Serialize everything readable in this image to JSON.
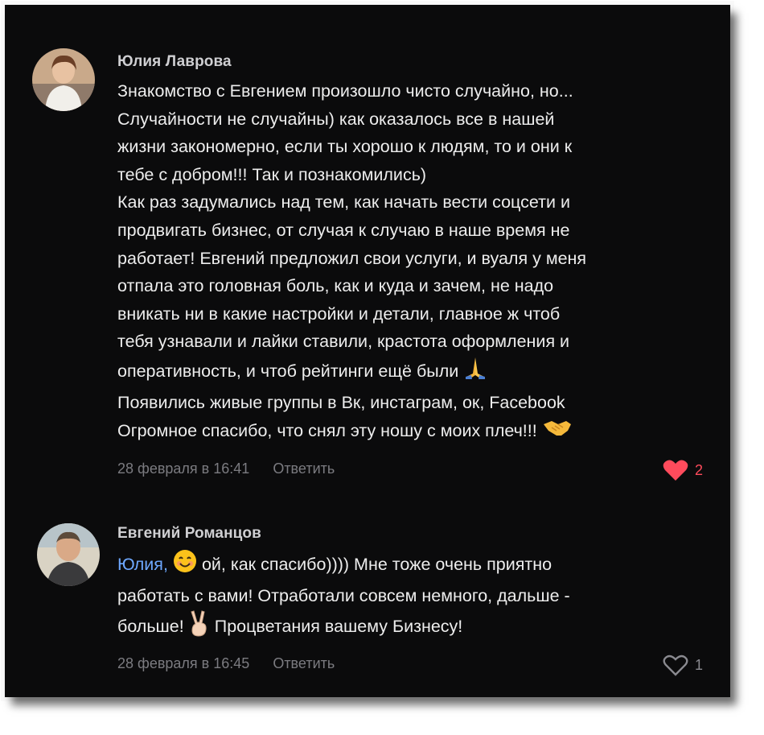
{
  "comments": [
    {
      "author": "Юлия Лаврова",
      "lines": [
        "Знакомство с Евгением произошло чисто случайно, но...",
        "Случайности не случайны) как оказалось все в нашей",
        "жизни закономерно, если ты хорошо к людям, то и они к",
        "тебе с добром!!! Так и познакомились)",
        "Как раз задумались над тем, как начать вести соцсети и",
        "продвигать бизнес, от случая к случаю в наше время не",
        "работает! Евгений предложил свои услуги, и вуаля у меня",
        "отпала это головная боль, как и куда и зачем, не надо",
        "вникать ни в какие настройки и детали, главное ж чтоб",
        "тебя узнавали и лайки ставили, крастота оформления и",
        "оперативность, и чтоб рейтинги ещё были",
        "Появились живые группы в Вк, инстаграм, ок, Facebook",
        "Огромное спасибо, что снял эту ношу с моих плеч!!!"
      ],
      "emoji_line10": "folded-hands-emoji",
      "emoji_line12": "handshake-emoji",
      "date": "28 февраля в 16:41",
      "reply_label": "Ответить",
      "likes": "2",
      "liked": true,
      "like_color": "#ff4b5c"
    },
    {
      "author": "Евгений Романцов",
      "mention": "Юлия,",
      "line1_rest": "ой, как спасибо)))) Мне тоже очень приятно",
      "line2": "работать с вами! Отработали совсем немного, дальше -",
      "line3_a": "больше!",
      "line3_b": "Процветания вашему Бизнесу!",
      "emoji_line1": "smiling-face-emoji",
      "emoji_line3": "victory-hand-emoji",
      "date": "28 февраля в 16:45",
      "reply_label": "Ответить",
      "likes": "1",
      "liked": false
    }
  ],
  "colors": {
    "background": "#0b0b0c",
    "text": "#ededed",
    "meta": "#7b7b80",
    "mention": "#6ea8ff"
  }
}
